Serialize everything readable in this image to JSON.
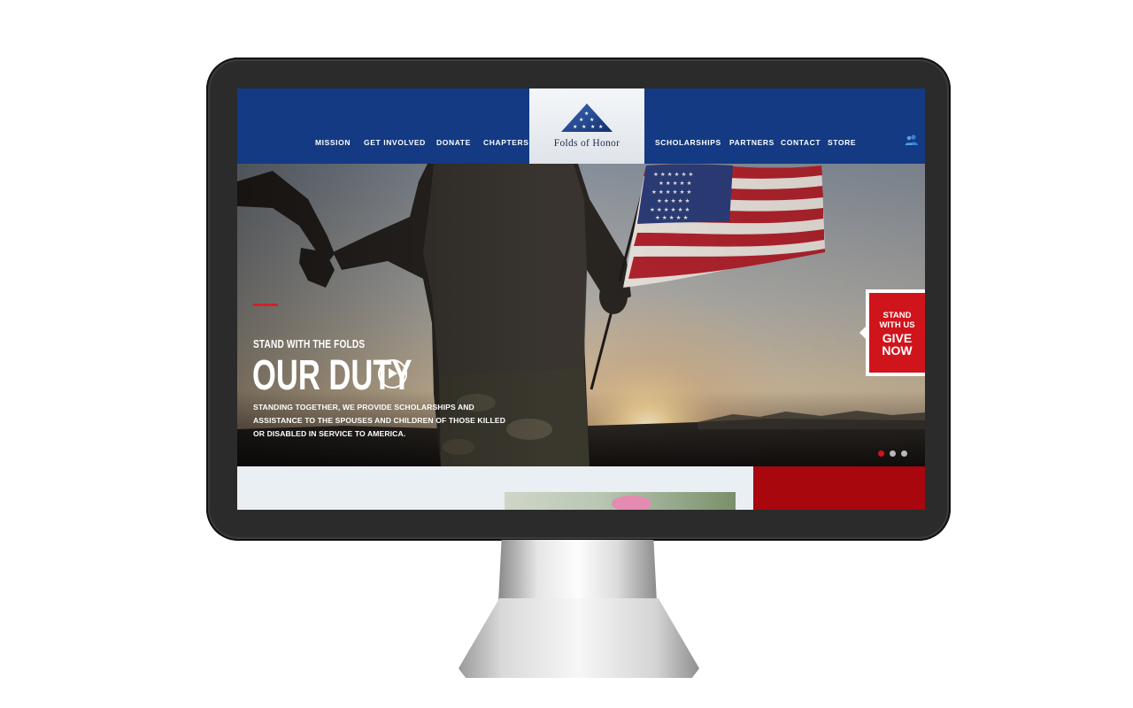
{
  "nav": {
    "left": [
      {
        "label": "MISSION"
      },
      {
        "label": "GET INVOLVED"
      },
      {
        "label": "DONATE"
      },
      {
        "label": "CHAPTERS"
      }
    ],
    "right": [
      {
        "label": "SCHOLARSHIPS"
      },
      {
        "label": "PARTNERS"
      },
      {
        "label": "CONTACT"
      },
      {
        "label": "STORE"
      }
    ],
    "account_icon": "users-icon"
  },
  "logo": {
    "brand_name": "Folds of Honor"
  },
  "hero": {
    "eyebrow": "STAND WITH THE FOLDS",
    "headline": "OUR DUTY",
    "body": "STANDING TOGETHER, WE PROVIDE SCHOLARSHIPS AND ASSISTANCE TO THE SPOUSES AND CHILDREN OF THOSE KILLED OR DISABLED IN SERVICE TO AMERICA.",
    "play_icon": "play-icon",
    "slider": {
      "total": 3,
      "active": 1
    }
  },
  "give_tab": {
    "line1": "STAND",
    "line2": "WITH US",
    "line3": "GIVE",
    "line4": "NOW"
  },
  "colors": {
    "header_blue": "#133a83",
    "accent_red": "#d0141c",
    "footer_red": "#a8070e"
  }
}
